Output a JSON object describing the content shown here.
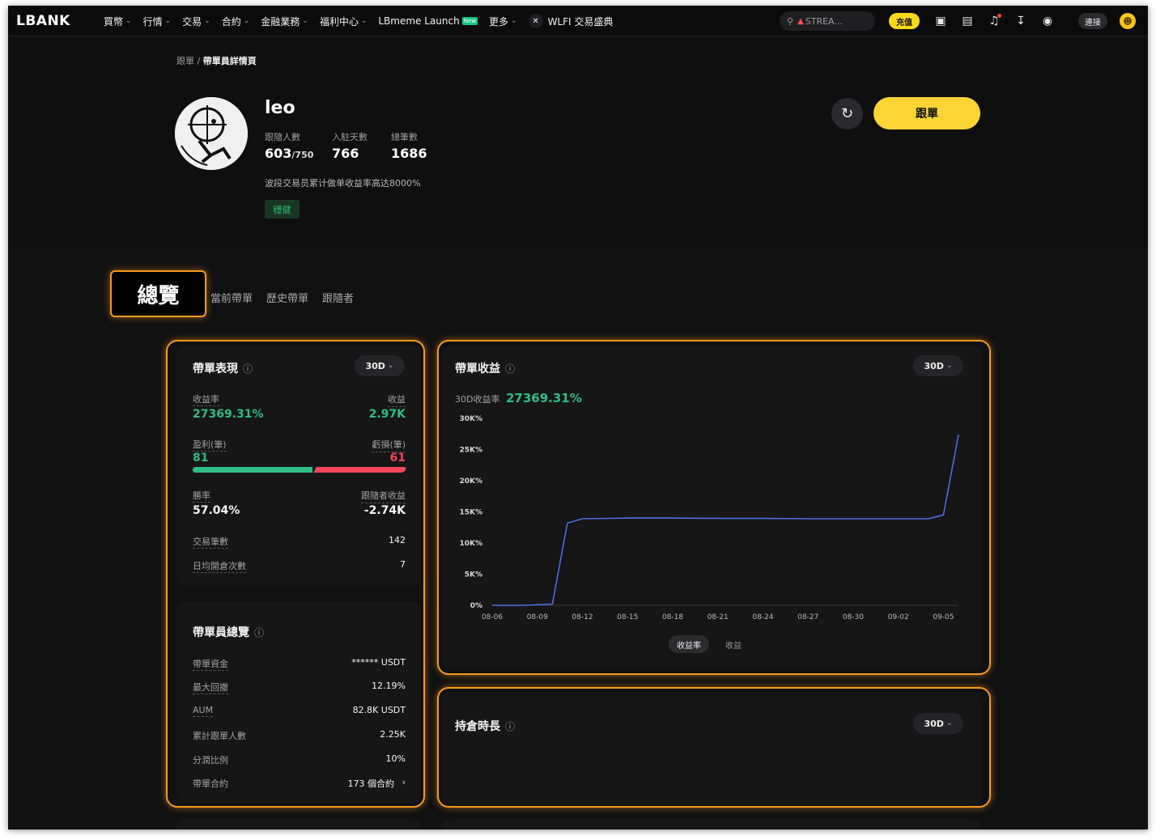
{
  "nav": {
    "logo": "LBANK",
    "menu": [
      {
        "label": "買幣"
      },
      {
        "label": "行情"
      },
      {
        "label": "交易"
      },
      {
        "label": "合約"
      },
      {
        "label": "金融業務"
      },
      {
        "label": "福利中心"
      },
      {
        "label": "LBmeme Launch",
        "badge": "New"
      },
      {
        "label": "更多"
      },
      {
        "label": "WLFI 交易盛典"
      }
    ],
    "search_placeholder": "STREA...",
    "deposit": "充值",
    "connect": "連接",
    "icons": [
      "wallet-icon",
      "document-icon",
      "bell-icon",
      "download-icon",
      "globe-icon"
    ]
  },
  "breadcrumb": {
    "parent": "跟單",
    "sep": "/",
    "current": "帶單員詳情頁"
  },
  "profile": {
    "name": "leo",
    "followers_label": "跟隨人數",
    "followers": "603",
    "followers_max": "/750",
    "days_label": "入駐天數",
    "days": "766",
    "orders_label": "總筆數",
    "orders": "1686",
    "description": "波段交易员累计做单收益率高达8000%",
    "tag": "穩健",
    "follow_button": "跟單"
  },
  "tabs": {
    "overview": "總覽",
    "current": "當前帶單",
    "history": "歷史帶單",
    "followers": "跟隨者"
  },
  "performance": {
    "title": "帶單表現",
    "period": "30D",
    "roi_label": "收益率",
    "roi": "27369.31%",
    "pnl_label": "收益",
    "pnl": "2.97K",
    "win_label": "盈利(筆)",
    "win": "81",
    "loss_label": "虧損(筆)",
    "loss": "61",
    "win_fraction": 0.5704,
    "winrate_label": "勝率",
    "winrate": "57.04%",
    "follower_pnl_label": "跟隨者收益",
    "follower_pnl": "-2.74K",
    "trades_label": "交易筆數",
    "trades": "142",
    "daily_label": "日均開倉次數",
    "daily": "7"
  },
  "overview": {
    "title": "帶單員總覽",
    "capital_label": "帶單資金",
    "capital": "****** USDT",
    "drawdown_label": "最大回撤",
    "drawdown": "12.19%",
    "aum_label": "AUM",
    "aum": "82.8K USDT",
    "total_followers_label": "累計跟單人數",
    "total_followers": "2.25K",
    "share_label": "分潤比例",
    "share": "10%",
    "contracts_label": "帶單合約",
    "contracts": "173 個合約"
  },
  "profit_chart": {
    "title": "帶單收益",
    "period": "30D",
    "roi_label": "30D收益率",
    "roi": "27369.31%",
    "toggle_roi": "收益率",
    "toggle_pnl": "收益"
  },
  "holding": {
    "title": "持倉時長",
    "period": "30D"
  },
  "chart_data": {
    "type": "line",
    "title": "",
    "xlabel": "",
    "ylabel": "",
    "y_ticks": [
      "0%",
      "5K%",
      "10K%",
      "15K%",
      "20K%",
      "25K%",
      "30K%"
    ],
    "ylim": [
      0,
      30000
    ],
    "x_ticks": [
      "08-06",
      "08-09",
      "08-12",
      "08-15",
      "08-18",
      "08-21",
      "08-24",
      "08-27",
      "08-30",
      "09-02",
      "09-05"
    ],
    "grid": false,
    "color": "#4a6ee0",
    "series": [
      {
        "x": [
          "08-06",
          "08-08",
          "08-10",
          "08-11",
          "08-12",
          "08-15",
          "08-18",
          "08-21",
          "08-24",
          "08-27",
          "08-30",
          "09-02",
          "09-04",
          "09-05",
          "09-06"
        ],
        "values": [
          0,
          0,
          200,
          13200,
          13900,
          14000,
          14000,
          13950,
          13950,
          13900,
          13900,
          13900,
          13900,
          14500,
          27369.31
        ]
      }
    ]
  }
}
